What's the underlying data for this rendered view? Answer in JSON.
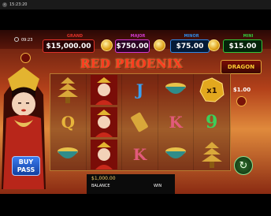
{
  "status": {
    "time": "15:23:20"
  },
  "game": {
    "clock": "09:23",
    "title": "RED PHOENIX",
    "side_logo": "DRAGON",
    "jackpots": [
      {
        "label": "GRAND",
        "value": "$15,000.00",
        "color": "#e0322a"
      },
      {
        "label": "MAJOR",
        "value": "$750.00",
        "color": "#d23ad0"
      },
      {
        "label": "MINOR",
        "value": "$75.00",
        "color": "#2f88e6"
      },
      {
        "label": "MINI",
        "value": "$15.00",
        "color": "#34c43a"
      }
    ],
    "side_bet": "$1.00",
    "multiplier": "x1",
    "buy_pass": "BUY PASS",
    "reels": [
      [
        "pagoda",
        "queen",
        "J",
        "bowl",
        "pagoda"
      ],
      [
        "Q",
        "queen",
        "scroll",
        "K",
        "9"
      ],
      [
        "bowl",
        "queen",
        "K",
        "bowl",
        "pagoda"
      ]
    ]
  },
  "footer": {
    "balance_value": "$1,000.00",
    "balance_label": "BALANCE",
    "win_label": "WIN"
  }
}
